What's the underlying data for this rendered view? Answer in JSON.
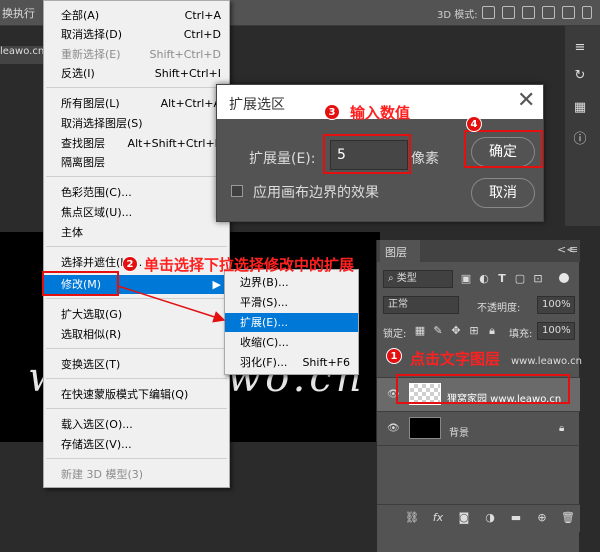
{
  "toolbar": {
    "left_label": "换执行",
    "mode_label": "3D 模式:"
  },
  "tab": {
    "url_fragment": "leawo.cn,"
  },
  "canvas": {
    "text": "www.leawo.cn"
  },
  "select_menu": {
    "items": [
      {
        "label": "全部(A)",
        "shortcut": "Ctrl+A",
        "disabled": false
      },
      {
        "label": "取消选择(D)",
        "shortcut": "Ctrl+D",
        "disabled": false
      },
      {
        "label": "重新选择(E)",
        "shortcut": "Shift+Ctrl+D",
        "disabled": true
      },
      {
        "label": "反选(I)",
        "shortcut": "Shift+Ctrl+I",
        "disabled": false
      },
      {
        "label": "所有图层(L)",
        "shortcut": "Alt+Ctrl+A",
        "disabled": false
      },
      {
        "label": "取消选择图层(S)",
        "shortcut": "",
        "disabled": false
      },
      {
        "label": "查找图层",
        "shortcut": "Alt+Shift+Ctrl+F",
        "disabled": false
      },
      {
        "label": "隔离图层",
        "shortcut": "",
        "disabled": false
      },
      {
        "label": "色彩范围(C)...",
        "shortcut": "",
        "disabled": false
      },
      {
        "label": "焦点区域(U)...",
        "shortcut": "",
        "disabled": false
      },
      {
        "label": "主体",
        "shortcut": "",
        "disabled": false
      },
      {
        "label": "选择并遮住(K)...",
        "shortcut": "",
        "disabled": false
      },
      {
        "label": "修改(M)",
        "shortcut": "",
        "disabled": false
      },
      {
        "label": "扩大选取(G)",
        "shortcut": "",
        "disabled": false
      },
      {
        "label": "选取相似(R)",
        "shortcut": "",
        "disabled": false
      },
      {
        "label": "变换选区(T)",
        "shortcut": "",
        "disabled": false
      },
      {
        "label": "在快速蒙版模式下编辑(Q)",
        "shortcut": "",
        "disabled": false
      },
      {
        "label": "载入选区(O)...",
        "shortcut": "",
        "disabled": false
      },
      {
        "label": "存储选区(V)...",
        "shortcut": "",
        "disabled": false
      },
      {
        "label": "新建 3D 模型(3)",
        "shortcut": "",
        "disabled": true
      }
    ]
  },
  "modify_submenu": {
    "items": [
      {
        "label": "边界(B)...",
        "shortcut": ""
      },
      {
        "label": "平滑(S)...",
        "shortcut": ""
      },
      {
        "label": "扩展(E)...",
        "shortcut": ""
      },
      {
        "label": "收缩(C)...",
        "shortcut": ""
      },
      {
        "label": "羽化(F)...",
        "shortcut": "Shift+F6"
      }
    ]
  },
  "dialog": {
    "title": "扩展选区",
    "close": "✕",
    "expand_label": "扩展量(E):",
    "expand_value": "5",
    "unit": "像素",
    "checkbox_label": "应用画布边界的效果",
    "ok": "确定",
    "cancel": "取消"
  },
  "layers_panel": {
    "title": "图层",
    "collapse": "<< ",
    "filter_label": "类型",
    "blend_mode": "正常",
    "opacity_label": "不透明度:",
    "opacity_value": "100%",
    "lock_label": "锁定:",
    "fill_label": "填充:",
    "fill_value": "100%",
    "layers": [
      {
        "name": "www.leawo.cn"
      },
      {
        "name": "狸窝家园 www.leawo.cn"
      },
      {
        "name": "背景"
      }
    ]
  },
  "annotations": {
    "step1": {
      "num": "1",
      "text": "点击文字图层"
    },
    "step2": {
      "num": "2",
      "text": "单击选择下拉选择修改中的扩展"
    },
    "step3": {
      "num": "3",
      "text": "输入数值"
    },
    "step4": {
      "num": "4",
      "text": ""
    }
  },
  "colors": {
    "menu_highlight": "#0078d7",
    "annotation": "#e41010"
  }
}
